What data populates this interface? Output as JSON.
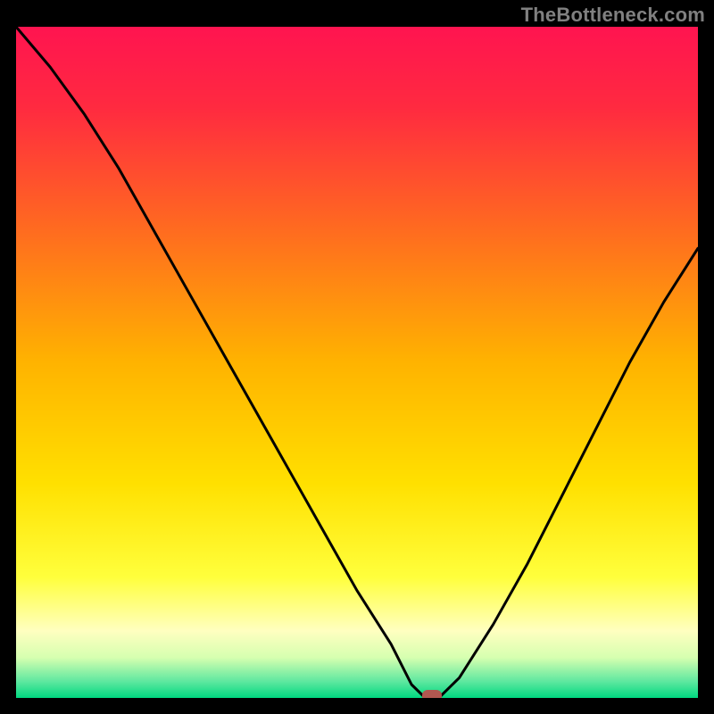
{
  "attribution": "TheBottleneck.com",
  "chart_data": {
    "type": "line",
    "title": "",
    "xlabel": "",
    "ylabel": "",
    "xlim": [
      0,
      100
    ],
    "ylim": [
      0,
      100
    ],
    "series": [
      {
        "name": "bottleneck-curve",
        "x": [
          0,
          5,
          10,
          15,
          20,
          25,
          30,
          35,
          40,
          45,
          50,
          55,
          58,
          60,
          62,
          65,
          70,
          75,
          80,
          85,
          90,
          95,
          100
        ],
        "y": [
          100,
          94,
          87,
          79,
          70,
          61,
          52,
          43,
          34,
          25,
          16,
          8,
          2,
          0,
          0,
          3,
          11,
          20,
          30,
          40,
          50,
          59,
          67
        ]
      }
    ],
    "marker": {
      "x": 61,
      "y": 0,
      "color": "#b15750"
    },
    "gradient_stops": [
      {
        "offset": 0.0,
        "color": "#ff1450"
      },
      {
        "offset": 0.12,
        "color": "#ff2a40"
      },
      {
        "offset": 0.3,
        "color": "#ff6a20"
      },
      {
        "offset": 0.5,
        "color": "#ffb300"
      },
      {
        "offset": 0.68,
        "color": "#ffe000"
      },
      {
        "offset": 0.82,
        "color": "#ffff3c"
      },
      {
        "offset": 0.9,
        "color": "#ffffc0"
      },
      {
        "offset": 0.94,
        "color": "#d6ffb0"
      },
      {
        "offset": 0.975,
        "color": "#60e8a0"
      },
      {
        "offset": 1.0,
        "color": "#00d880"
      }
    ]
  }
}
